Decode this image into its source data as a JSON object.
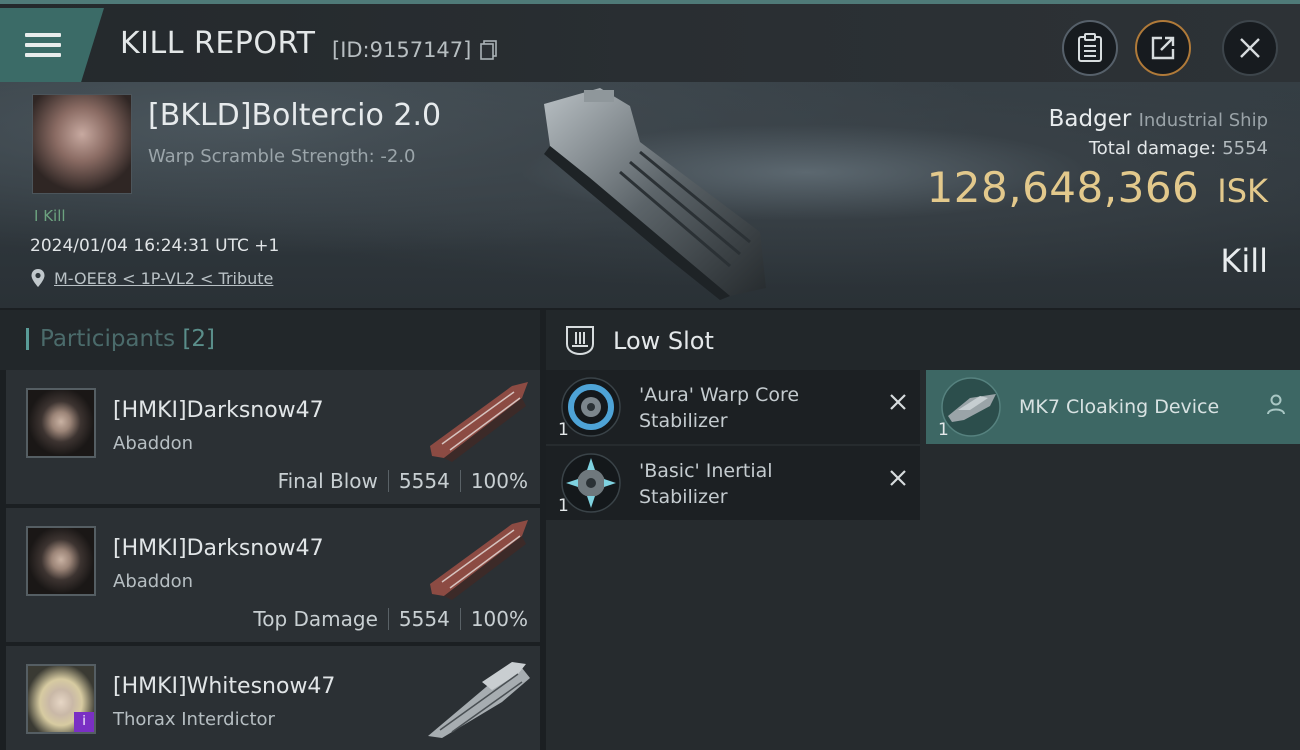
{
  "header": {
    "title": "KILL REPORT",
    "id": "[ID:9157147]"
  },
  "victim": {
    "name": "[BKLD]Boltercio 2.0",
    "warp_scramble": "Warp Scramble Strength: -2.0",
    "kill_tag": "I Kill",
    "timestamp": "2024/01/04 16:24:31 UTC +1",
    "location": "M-OEE8 < 1P-VL2 < Tribute",
    "ship_name": "Badger",
    "ship_class": "Industrial Ship",
    "total_damage_label": "Total damage:",
    "total_damage_value": "5554",
    "isk_value": "128,648,366",
    "isk_unit": "ISK",
    "result": "Kill"
  },
  "participants": {
    "title": "Participants",
    "count": "[2]",
    "items": [
      {
        "name": "[HMKI]Darksnow47",
        "ship": "Abaddon",
        "role": "Final Blow",
        "damage": "5554",
        "percent": "100%"
      },
      {
        "name": "[HMKI]Darksnow47",
        "ship": "Abaddon",
        "role": "Top Damage",
        "damage": "5554",
        "percent": "100%"
      },
      {
        "name": "[HMKI]Whitesnow47",
        "ship": "Thorax Interdictor",
        "badge": "i"
      }
    ]
  },
  "low_slot": {
    "title": "Low Slot",
    "modules": [
      {
        "line1": "'Aura' Warp Core",
        "line2": "Stabilizer",
        "qty": "1"
      },
      {
        "line1": "'Basic' Inertial",
        "line2": "Stabilizer",
        "qty": "1"
      },
      {
        "line1": "MK7 Cloaking Device",
        "qty": "1"
      }
    ]
  },
  "colors": {
    "accent_teal": "#3b6b67",
    "isk_gold": "#e3c98c",
    "kill_green": "#6ca27f",
    "highlight_row": "#3d6764"
  }
}
